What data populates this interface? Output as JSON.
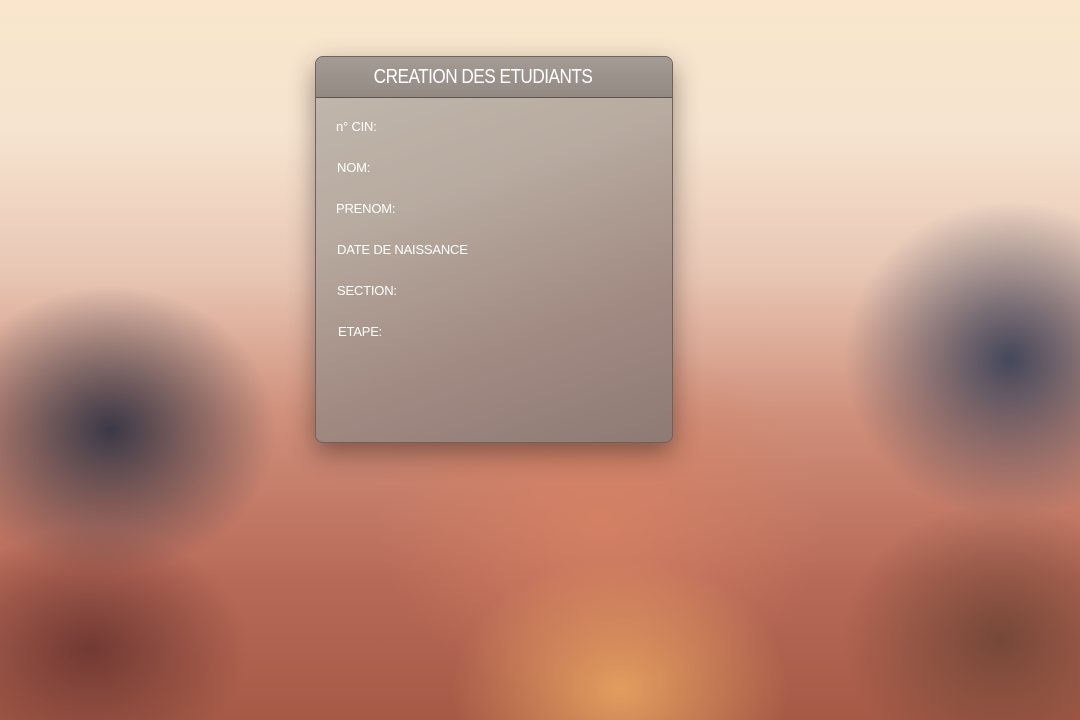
{
  "form": {
    "title": "CREATION DES ETUDIANTS",
    "fields": [
      {
        "label": "n° CIN:",
        "value": ""
      },
      {
        "label": "NOM:",
        "value": ""
      },
      {
        "label": "PRENOM:",
        "value": ""
      },
      {
        "label": "DATE DE NAISSANCE",
        "value": ""
      },
      {
        "label": "SECTION:",
        "value": ""
      },
      {
        "label": "ETAPE:",
        "value": ""
      }
    ]
  },
  "colors": {
    "panel": "#b3a69c",
    "header": "#9a918b",
    "text": "#ffffff"
  }
}
